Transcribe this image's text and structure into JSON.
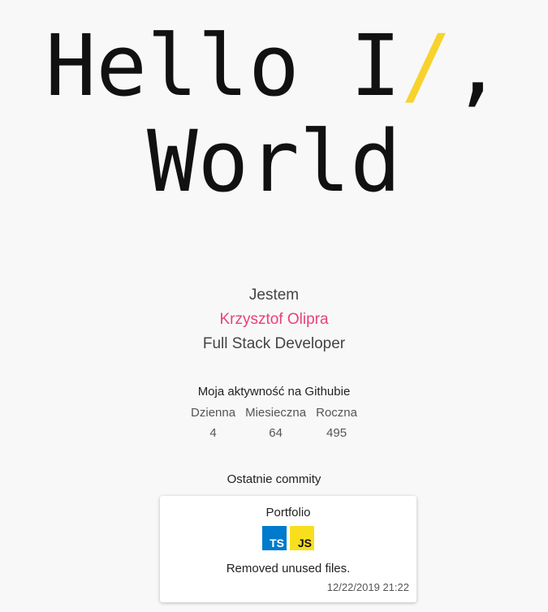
{
  "hero": {
    "line1_before": "Hello I",
    "line1_slash": "/",
    "line1_after": ",",
    "line2": "World",
    "accent_color": "#f6d32d"
  },
  "intro": {
    "prefix": "Jestem",
    "name": "Krzysztof Olipra",
    "role": "Full Stack Developer",
    "name_color": "#e8417a"
  },
  "activity": {
    "title": "Moja aktywność na Githubie",
    "columns": [
      {
        "label": "Dzienna",
        "value": "4"
      },
      {
        "label": "Miesieczna",
        "value": "64"
      },
      {
        "label": "Roczna",
        "value": "495"
      }
    ]
  },
  "commits": {
    "title": "Ostatnie commity",
    "items": [
      {
        "repo": "Portfolio",
        "languages": [
          {
            "label": "TS",
            "icon": "typescript-icon",
            "color": "#007acc"
          },
          {
            "label": "JS",
            "icon": "javascript-icon",
            "color": "#f7df1e"
          }
        ],
        "message": "Removed unused files.",
        "date": "12/22/2019 21:22"
      }
    ]
  }
}
